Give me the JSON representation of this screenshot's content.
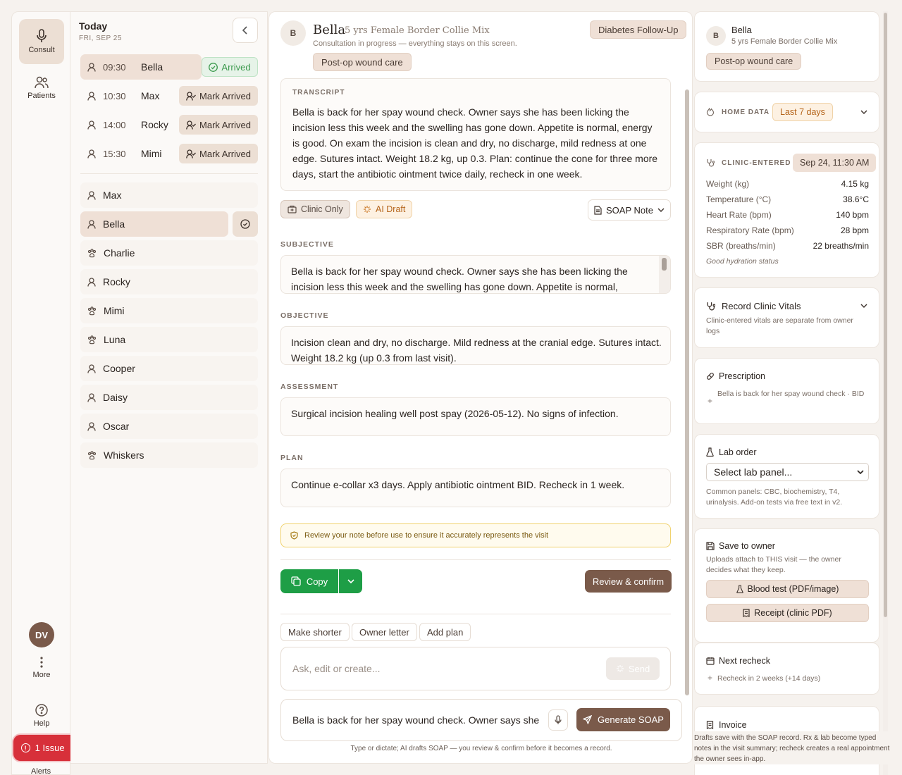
{
  "rail": {
    "consult": "Consult",
    "patients": "Patients",
    "avatar": "DV",
    "more": "More",
    "help": "Help",
    "issue": "1 Issue",
    "alerts": "Alerts"
  },
  "schedule": {
    "title": "Today",
    "date": "FRI, SEP 25",
    "appointments": [
      {
        "time": "09:30",
        "name": "Bella",
        "action": "Arrived"
      },
      {
        "time": "10:30",
        "name": "Max",
        "action": "Mark Arrived"
      },
      {
        "time": "14:00",
        "name": "Rocky",
        "action": "Mark Arrived"
      },
      {
        "time": "15:30",
        "name": "Mimi",
        "action": "Mark Arrived"
      }
    ],
    "patients": [
      "Max",
      "Bella",
      "Charlie",
      "Rocky",
      "Mimi",
      "Luna",
      "Cooper",
      "Daisy",
      "Oscar",
      "Whiskers"
    ]
  },
  "consult": {
    "avatar": "B",
    "name": "Bella",
    "desc": "5 yrs Female Border Collie Mix",
    "status": "Consultation in progress — everything stays on this screen.",
    "tag": "Post-op wound care",
    "visit_type": "Diabetes Follow-Up",
    "transcript_label": "TRANSCRIPT",
    "transcript": "Bella is back for her spay wound check. Owner says she has been licking the incision less this week and the swelling has gone down. Appetite is normal, energy is good. On exam the incision is clean and dry, no discharge, mild redness at one edge. Sutures intact. Weight 18.2 kg, up 0.3. Plan: continue the cone for three more days, start the antibiotic ointment twice daily, recheck in one week.",
    "clinic_only": "Clinic Only",
    "ai_draft": "AI Draft",
    "note_type": "SOAP Note",
    "subjective_label": "SUBJECTIVE",
    "subjective": "Bella is back for her spay wound check. Owner says she has been licking the incision less this week and the swelling has gone down. Appetite is normal,",
    "objective_label": "OBJECTIVE",
    "objective": "Incision clean and dry, no discharge. Mild redness at the cranial edge. Sutures intact. Weight 18.2 kg (up 0.3 from last visit).",
    "assessment_label": "ASSESSMENT",
    "assessment": "Surgical incision healing well post spay (2026-05-12). No signs of infection.",
    "plan_label": "PLAN",
    "plan": "Continue e-collar x3 days. Apply antibiotic ointment BID. Recheck in 1 week.",
    "warning": "Review your note before use to ensure it accurately represents the visit",
    "copy": "Copy",
    "review": "Review & confirm",
    "quick_actions": [
      "Make shorter",
      "Owner letter",
      "Add plan"
    ],
    "ask_placeholder": "Ask, edit or create...",
    "send": "Send",
    "dictation": "Bella is back for her spay wound check. Owner says she",
    "generate": "Generate SOAP",
    "footer": "Type or dictate; AI drafts SOAP — you review & confirm before it becomes a record."
  },
  "side": {
    "avatar": "B",
    "name": "Bella",
    "desc": "5 yrs Female Border Collie Mix",
    "tag": "Post-op wound care",
    "home_data_label": "HOME DATA",
    "home_data_range": "Last 7 days",
    "clinic_label": "CLINIC-ENTERED",
    "clinic_date": "Sep 24, 11:30 AM",
    "vitals": [
      {
        "k": "Weight (kg)",
        "v": "4.15 kg"
      },
      {
        "k": "Temperature (°C)",
        "v": "38.6°C"
      },
      {
        "k": "Heart Rate (bpm)",
        "v": "140 bpm"
      },
      {
        "k": "Respiratory Rate (bpm)",
        "v": "28 bpm"
      },
      {
        "k": "SBR (breaths/min)",
        "v": "22 breaths/min"
      }
    ],
    "hydration": "Good hydration status",
    "record_title": "Record Clinic Vitals",
    "record_sub": "Clinic-entered vitals are separate from owner logs",
    "rx_title": "Prescription",
    "rx_item": "Bella is back for her spay wound check · BID",
    "lab_title": "Lab order",
    "lab_select": "Select lab panel...",
    "lab_sub": "Common panels: CBC, biochemistry, T4, urinalysis. Add-on tests via free text in v2.",
    "save_title": "Save to owner",
    "save_sub": "Uploads attach to THIS visit — the owner decides what they keep.",
    "save_blood": "Blood test (PDF/image)",
    "save_receipt": "Receipt (clinic PDF)",
    "recheck_title": "Next recheck",
    "recheck_item": "Recheck in 2 weeks (+14 days)",
    "invoice_title": "Invoice",
    "bottom_note": "Drafts save with the SOAP record. Rx & lab become typed notes in the visit summary; recheck creates a real appointment the owner sees in-app."
  }
}
